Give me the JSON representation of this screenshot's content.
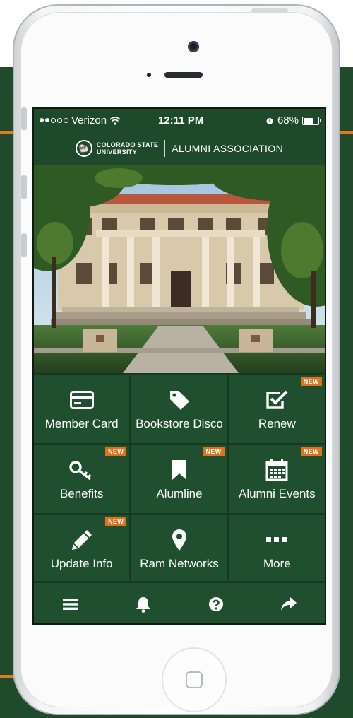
{
  "status_bar": {
    "carrier": "Verizon",
    "time": "12:11 PM",
    "battery": "68%",
    "battery_level": 0.68
  },
  "header": {
    "university": [
      "COLORADO STATE",
      "UNIVERSITY"
    ],
    "title": "ALUMNI ASSOCIATION"
  },
  "tiles": [
    {
      "label": "Member Card",
      "icon": "credit-card-icon",
      "badge": ""
    },
    {
      "label": "Bookstore Disco",
      "icon": "tag-icon",
      "badge": ""
    },
    {
      "label": "Renew",
      "icon": "checkbox-icon",
      "badge": "NEW"
    },
    {
      "label": "Benefits",
      "icon": "key-icon",
      "badge": "NEW"
    },
    {
      "label": "Alumline",
      "icon": "bookmark-icon",
      "badge": "NEW"
    },
    {
      "label": "Alumni Events",
      "icon": "calendar-icon",
      "badge": "NEW"
    },
    {
      "label": "Update Info",
      "icon": "pencil-icon",
      "badge": "NEW"
    },
    {
      "label": "Ram Networks",
      "icon": "map-pin-icon",
      "badge": ""
    },
    {
      "label": "More",
      "icon": "more-dots-icon",
      "badge": ""
    }
  ],
  "bottom_bar": [
    "menu-icon",
    "bell-icon",
    "help-icon",
    "share-icon"
  ],
  "colors": {
    "brand_green": "#1e4a2b",
    "tile_green": "#1f4f2e",
    "accent_orange": "#d9731d"
  }
}
